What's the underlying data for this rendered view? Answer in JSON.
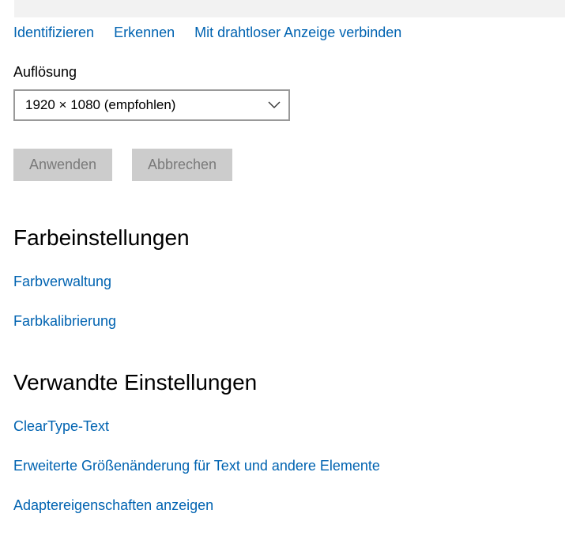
{
  "top_links": {
    "identify": "Identifizieren",
    "detect": "Erkennen",
    "connect_wireless": "Mit drahtloser Anzeige verbinden"
  },
  "resolution": {
    "label": "Auflösung",
    "selected_value": "1920 × 1080 (empfohlen)"
  },
  "buttons": {
    "apply": "Anwenden",
    "cancel": "Abbrechen"
  },
  "color_settings": {
    "title": "Farbeinstellungen",
    "links": {
      "color_management": "Farbverwaltung",
      "color_calibration": "Farbkalibrierung"
    }
  },
  "related_settings": {
    "title": "Verwandte Einstellungen",
    "links": {
      "cleartype": "ClearType-Text",
      "advanced_sizing": "Erweiterte Größenänderung für Text und andere Elemente",
      "adapter_properties": "Adaptereigenschaften anzeigen"
    }
  },
  "colors": {
    "link": "#0063b1",
    "button_disabled_bg": "#cccccc",
    "button_disabled_text": "#7a7a7a",
    "dropdown_border": "#999999"
  },
  "icons": {
    "dropdown": "chevron-down-icon"
  }
}
